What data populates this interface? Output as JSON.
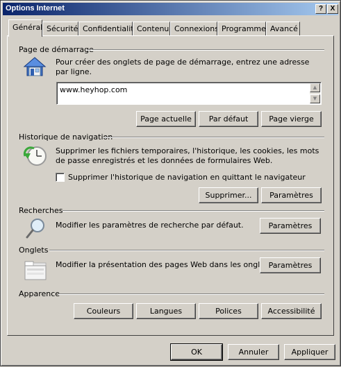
{
  "window": {
    "title": "Options Internet",
    "help_label": "?",
    "close_label": "X"
  },
  "tabs": [
    {
      "label": "Général",
      "active": true
    },
    {
      "label": "Sécurité"
    },
    {
      "label": "Confidentialité"
    },
    {
      "label": "Contenu"
    },
    {
      "label": "Connexions"
    },
    {
      "label": "Programmes"
    },
    {
      "label": "Avancé"
    }
  ],
  "home": {
    "title": "Page de démarrage",
    "description": "Pour créer des onglets de page de démarrage, entrez une adresse par ligne.",
    "value": "www.heyhop.com",
    "buttons": {
      "current": "Page actuelle",
      "default": "Par défaut",
      "blank": "Page vierge"
    }
  },
  "history": {
    "title": "Historique de navigation",
    "description": "Supprimer les fichiers temporaires, l'historique, les cookies, les mots de passe enregistrés et les données de formulaires Web.",
    "checkbox_label": "Supprimer l'historique de navigation en quittant le navigateur",
    "checkbox_checked": false,
    "buttons": {
      "delete": "Supprimer...",
      "settings": "Paramètres"
    }
  },
  "search": {
    "title": "Recherches",
    "description": "Modifier les paramètres de recherche par défaut.",
    "settings": "Paramètres"
  },
  "tabs_group": {
    "title": "Onglets",
    "description": "Modifier la présentation des pages Web dans les onglets.",
    "settings": "Paramètres"
  },
  "appearance": {
    "title": "Apparence",
    "buttons": {
      "colors": "Couleurs",
      "languages": "Langues",
      "fonts": "Polices",
      "accessibility": "Accessibilité"
    }
  },
  "footer": {
    "ok": "OK",
    "cancel": "Annuler",
    "apply": "Appliquer"
  },
  "colors": {
    "titlebar_start": "#0a246a",
    "titlebar_end": "#a6caf0",
    "face": "#d4d0c8"
  }
}
